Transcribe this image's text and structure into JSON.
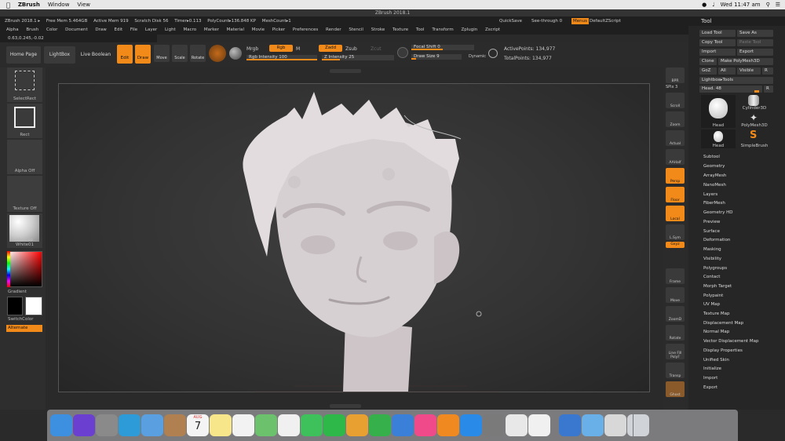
{
  "menubar": {
    "app": "ZBrush",
    "items": [
      "Window",
      "View"
    ],
    "clock": "Wed 11:47 am"
  },
  "window_title": "ZBrush 2018.1",
  "info_row": {
    "left": [
      "ZBrush 2018.1 ▸",
      "Free Mem 5.464GB",
      "Active Mem 919",
      "Scratch Disk 56",
      "Timer▸0.113",
      "PolyCount▸136.848 KP",
      "MeshCount▸1"
    ],
    "quicksave": "QuickSave",
    "seethrough": "See-through  0",
    "menus": "Menus",
    "default_zscript": "DefaultZScript"
  },
  "menu_items": [
    "Alpha",
    "Brush",
    "Color",
    "Document",
    "Draw",
    "Edit",
    "File",
    "Layer",
    "Light",
    "Macro",
    "Marker",
    "Material",
    "Movie",
    "Picker",
    "Preferences",
    "Render",
    "Stencil",
    "Stroke",
    "Texture",
    "Tool",
    "Transform",
    "Zplugin",
    "Zscript"
  ],
  "coords": "0.63,0.245,-0.02",
  "toolbar": {
    "home": "Home Page",
    "lightbox": "LightBox",
    "live_boolean": "Live Boolean",
    "edit": "Edit",
    "draw": "Draw",
    "move": "Move",
    "scale": "Scale",
    "rotate": "Rotate",
    "mrgb": "Mrgb",
    "rgb": "Rgb",
    "m": "M",
    "zadd": "Zadd",
    "zsub": "Zsub",
    "zcut": "Zcut",
    "rgb_intensity": "Rgb Intensity 100",
    "z_intensity": "Z Intensity 25",
    "focal_shift": "Focal Shift 0",
    "draw_size": "Draw Size 9",
    "dynamic": "Dynamic",
    "active_points": "ActivePoints: 134,977",
    "total_points": "TotalPoints: 134,977"
  },
  "left_shelf": {
    "select_rect": "SelectRect",
    "rect": "Rect",
    "alpha_off": "Alpha Off",
    "texture_off": "Texture Off",
    "matcap": "MatCap White01",
    "gradient": "Gradient",
    "switch_color": "SwitchColor",
    "alternate": "Alternate"
  },
  "right_shelf": [
    "BPR",
    "SPix 3",
    "Scroll",
    "Zoom",
    "Actual",
    "AAHalf",
    "Persp",
    "Floor",
    "Local",
    "L.Sym",
    "Gxyz",
    "Frame",
    "Move",
    "ZoomD",
    "Rotate",
    "Line Fill PolyF",
    "Transp",
    "Ghost"
  ],
  "tool_palette": {
    "title": "Tool",
    "load_tool": "Load Tool",
    "save_as": "Save As",
    "copy_tool": "Copy Tool",
    "paste_tool": "Paste Tool",
    "import": "Import",
    "export": "Export",
    "clone": "Clone",
    "make_polymesh": "Make PolyMesh3D",
    "goz": "GoZ",
    "all": "All",
    "visible": "Visible",
    "r": "R",
    "lightbox_tools": "Lightbox▸Tools",
    "head_slider": "Head. 48",
    "r2": "R",
    "thumbs": [
      "Head",
      "Cylinder3D",
      "PolyMesh3D",
      "Head",
      "SimpleBrush"
    ],
    "subpalettes": [
      "Subtool",
      "Geometry",
      "ArrayMesh",
      "NanoMesh",
      "Layers",
      "FiberMesh",
      "Geometry HD",
      "Preview",
      "Surface",
      "Deformation",
      "Masking",
      "Visibility",
      "Polygroups",
      "Contact",
      "Morph Target",
      "Polypaint",
      "UV Map",
      "Texture Map",
      "Displacement Map",
      "Normal Map",
      "Vector Displacement Map",
      "Display Properties",
      "Unified Skin",
      "Initialize",
      "Import",
      "Export"
    ]
  },
  "dock": {
    "calendar_month": "AUG",
    "calendar_day": "7",
    "apps": [
      {
        "name": "finder-icon",
        "color": "#3d8fe0"
      },
      {
        "name": "siri-icon",
        "color": "#6b3fd0"
      },
      {
        "name": "launchpad-icon",
        "color": "#8a8a8a"
      },
      {
        "name": "safari-icon",
        "color": "#2c9bd8"
      },
      {
        "name": "mail-icon",
        "color": "#5aa0e0"
      },
      {
        "name": "contacts-icon",
        "color": "#b08050"
      },
      {
        "name": "calendar-icon",
        "color": "#f4f4f4"
      },
      {
        "name": "notes-icon",
        "color": "#f8e68a"
      },
      {
        "name": "reminders-icon",
        "color": "#f2f2f2"
      },
      {
        "name": "maps-icon",
        "color": "#6cc26c"
      },
      {
        "name": "photos-icon",
        "color": "#f0f0f0"
      },
      {
        "name": "messages-icon",
        "color": "#3ec05a"
      },
      {
        "name": "facetime-icon",
        "color": "#2eb84a"
      },
      {
        "name": "pages-icon",
        "color": "#e8a030"
      },
      {
        "name": "numbers-icon",
        "color": "#36b04a"
      },
      {
        "name": "keynote-icon",
        "color": "#3a80d8"
      },
      {
        "name": "itunes-icon",
        "color": "#f04a8a"
      },
      {
        "name": "ibooks-icon",
        "color": "#f08a20"
      },
      {
        "name": "appstore-icon",
        "color": "#2a8ae8"
      },
      {
        "name": "system-prefs-icon",
        "color": "#7a7a7a"
      },
      {
        "name": "chrome-icon",
        "color": "#e8e8e8"
      },
      {
        "name": "zbrush-icon",
        "color": "#f0f0f0"
      },
      {
        "name": "network-icon",
        "color": "#3a78d0"
      },
      {
        "name": "folder-icon",
        "color": "#6ab0e8"
      },
      {
        "name": "preview-icon",
        "color": "#d8d8d8"
      },
      {
        "name": "trash-icon",
        "color": "#d0d4d8"
      }
    ]
  },
  "colors": {
    "accent": "#f28a1a",
    "bg": "#2a2a2a",
    "panel": "#262626"
  }
}
